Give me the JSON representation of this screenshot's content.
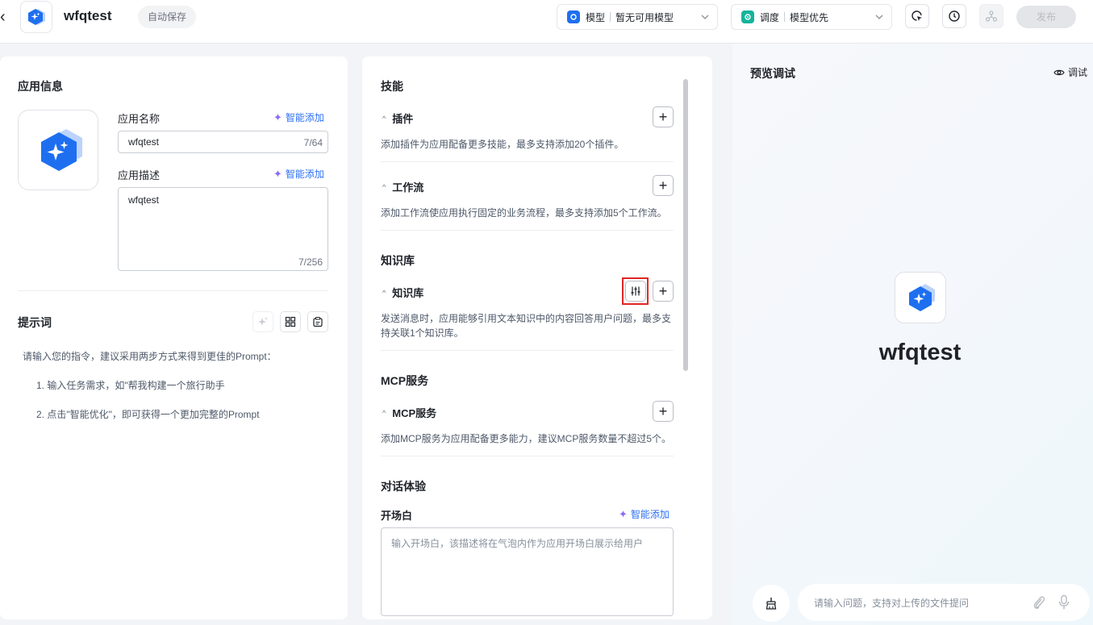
{
  "header": {
    "back_glyph": "‹",
    "app_name": "wfqtest",
    "autosave": "自动保存",
    "model": {
      "key": "模型",
      "value": "暂无可用模型"
    },
    "schedule": {
      "key": "调度",
      "value": "模型优先"
    },
    "publish": "发布"
  },
  "app_info": {
    "title": "应用信息",
    "name_label": "应用名称",
    "name_value": "wfqtest",
    "name_count": "7/64",
    "desc_label": "应用描述",
    "desc_value": "wfqtest",
    "desc_count": "7/256",
    "ai_add": "智能添加"
  },
  "prompt": {
    "title": "提示词",
    "hint_intro": "请输入您的指令，建议采用两步方式来得到更佳的Prompt：",
    "step1": "1. 输入任务需求，如\"帮我构建一个旅行助手",
    "step2": "2. 点击\"智能优化\"，即可获得一个更加完整的Prompt"
  },
  "skills": {
    "title": "技能",
    "plugin_title": "插件",
    "plugin_desc": "添加插件为应用配备更多技能，最多支持添加20个插件。",
    "workflow_title": "工作流",
    "workflow_desc": "添加工作流使应用执行固定的业务流程，最多支持添加5个工作流。"
  },
  "knowledge": {
    "title": "知识库",
    "sub_title": "知识库",
    "desc_line1": "发送消息时，应用能够引用文本知识中的内容回答用户问题，最多支",
    "desc_line2": "持关联1个知识库。"
  },
  "mcp": {
    "title": "MCP服务",
    "sub_title": "MCP服务",
    "desc": "添加MCP服务为应用配备更多能力，建议MCP服务数量不超过5个。"
  },
  "dialog": {
    "title": "对话体验",
    "opening_label": "开场白",
    "ai_add": "智能添加",
    "opening_placeholder": "输入开场白，该描述将在气泡内作为应用开场白展示给用户"
  },
  "preview": {
    "title": "预览调试",
    "debug": "调试",
    "app_name": "wfqtest",
    "input_placeholder": "请输入问题，支持对上传的文件提问"
  },
  "colors": {
    "accent": "#2b6ff7",
    "logo_blue": "#1e6ff0",
    "schedule_teal": "#16b39a",
    "highlight_red": "#e12626"
  }
}
